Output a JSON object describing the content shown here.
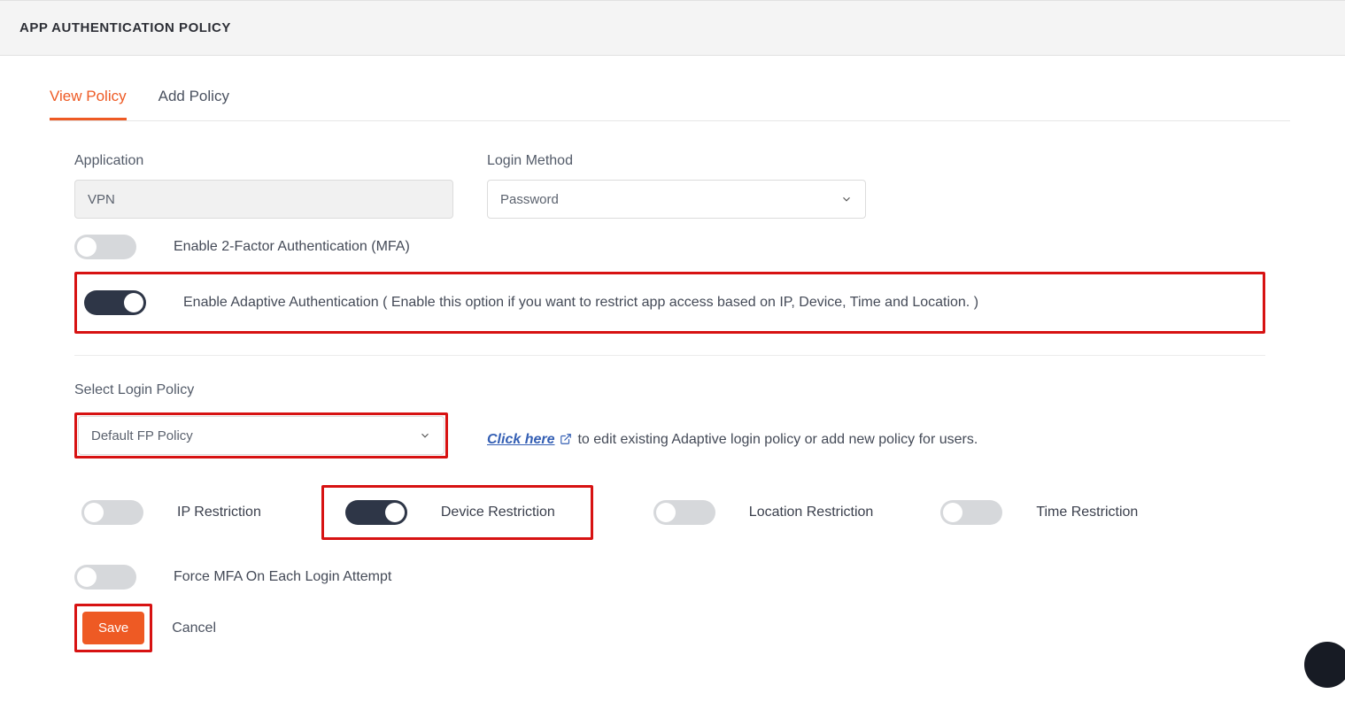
{
  "header": {
    "title": "APP AUTHENTICATION POLICY"
  },
  "tabs": {
    "view": "View Policy",
    "add": "Add Policy"
  },
  "form": {
    "application_label": "Application",
    "application_value": "VPN",
    "login_method_label": "Login Method",
    "login_method_value": "Password",
    "mfa_label": "Enable 2-Factor Authentication (MFA)",
    "adaptive_label": "Enable Adaptive Authentication ( Enable this option if you want to restrict app access based on IP, Device, Time and Location. )",
    "select_login_policy_label": "Select Login Policy",
    "login_policy_value": "Default FP Policy",
    "click_here": "Click here",
    "click_here_suffix": "to edit existing Adaptive login policy or add new policy for users.",
    "restrictions": {
      "ip": "IP Restriction",
      "device": "Device Restriction",
      "location": "Location Restriction",
      "time": "Time Restriction"
    },
    "force_mfa_label": "Force MFA On Each Login Attempt",
    "save": "Save",
    "cancel": "Cancel"
  }
}
